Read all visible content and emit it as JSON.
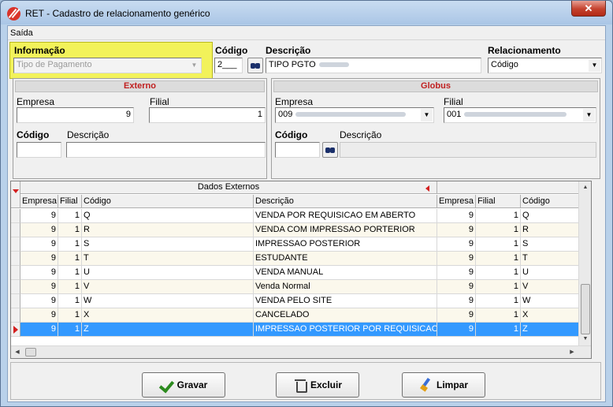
{
  "window": {
    "title": "RET - Cadastro de relacionamento genérico",
    "close_glyph": "✕"
  },
  "menu": {
    "saida": "Saída"
  },
  "top": {
    "informacao_label": "Informação",
    "informacao_value": "Tipo de Pagamento",
    "codigo_label": "Código",
    "codigo_value": "2___",
    "descricao_label": "Descrição",
    "descricao_value": "TIPO PGTO",
    "relacionamento_label": "Relacionamento",
    "relacionamento_value": "Código"
  },
  "externo": {
    "title": "Externo",
    "empresa_label": "Empresa",
    "empresa_value": "9",
    "filial_label": "Filial",
    "filial_value": "1",
    "codigo_label": "Código",
    "codigo_value": "",
    "descricao_label": "Descrição",
    "descricao_value": ""
  },
  "globus": {
    "title": "Globus",
    "empresa_label": "Empresa",
    "empresa_value": "009",
    "filial_label": "Filial",
    "filial_value": "001",
    "codigo_label": "Código",
    "codigo_value": "",
    "descricao_label": "Descrição",
    "descricao_value": ""
  },
  "grid": {
    "group_header": "Dados Externos",
    "columns": [
      "Empresa",
      "Filial",
      "Código",
      "Descrição",
      "Empresa",
      "Filial",
      "Código"
    ],
    "rows": [
      {
        "empresa": "9",
        "filial": "1",
        "codigo": "Q",
        "descricao": "VENDA POR REQUISICAO EM ABERTO",
        "g_empresa": "9",
        "g_filial": "1",
        "g_codigo": "Q"
      },
      {
        "empresa": "9",
        "filial": "1",
        "codigo": "R",
        "descricao": "VENDA COM IMPRESSAO PORTERIOR",
        "g_empresa": "9",
        "g_filial": "1",
        "g_codigo": "R"
      },
      {
        "empresa": "9",
        "filial": "1",
        "codigo": "S",
        "descricao": "IMPRESSAO POSTERIOR",
        "g_empresa": "9",
        "g_filial": "1",
        "g_codigo": "S"
      },
      {
        "empresa": "9",
        "filial": "1",
        "codigo": "T",
        "descricao": "ESTUDANTE",
        "g_empresa": "9",
        "g_filial": "1",
        "g_codigo": "T"
      },
      {
        "empresa": "9",
        "filial": "1",
        "codigo": "U",
        "descricao": "VENDA MANUAL",
        "g_empresa": "9",
        "g_filial": "1",
        "g_codigo": "U"
      },
      {
        "empresa": "9",
        "filial": "1",
        "codigo": "V",
        "descricao": "Venda Normal",
        "g_empresa": "9",
        "g_filial": "1",
        "g_codigo": "V"
      },
      {
        "empresa": "9",
        "filial": "1",
        "codigo": "W",
        "descricao": "VENDA PELO SITE",
        "g_empresa": "9",
        "g_filial": "1",
        "g_codigo": "W"
      },
      {
        "empresa": "9",
        "filial": "1",
        "codigo": "X",
        "descricao": "CANCELADO",
        "g_empresa": "9",
        "g_filial": "1",
        "g_codigo": "X"
      },
      {
        "empresa": "9",
        "filial": "1",
        "codigo": "Z",
        "descricao": "IMPRESSAO POSTERIOR POR REQUISICAO",
        "g_empresa": "9",
        "g_filial": "1",
        "g_codigo": "Z"
      }
    ],
    "selected_row": 8
  },
  "buttons": {
    "gravar": "Gravar",
    "excluir": "Excluir",
    "limpar": "Limpar"
  },
  "colors": {
    "highlight": "#f2f25a",
    "selection": "#3399ff",
    "panel_title": "#c02020"
  }
}
